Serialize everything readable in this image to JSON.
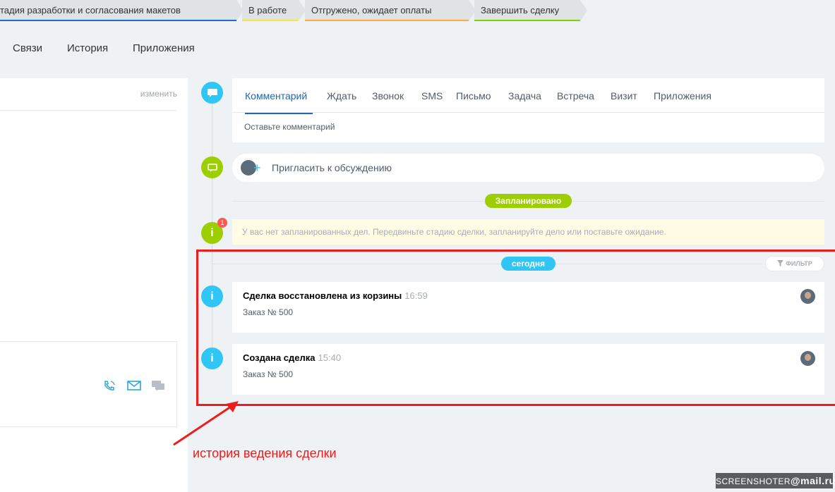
{
  "stages": [
    {
      "label": "тадия разработки и согласования макетов",
      "color": "#1e6ec8"
    },
    {
      "label": "В работе",
      "color": "#f7e43c"
    },
    {
      "label": "Отгружено, ожидает оплаты",
      "color": "#ffaa3c"
    },
    {
      "label": "Завершить сделку",
      "color": "#7bd500"
    }
  ],
  "top_tabs": [
    "Связи",
    "История",
    "Приложения"
  ],
  "left_panel": {
    "edit_label": "изменить"
  },
  "editor": {
    "tabs": [
      "Комментарий",
      "Ждать",
      "Звонок",
      "SMS",
      "Письмо",
      "Задача",
      "Встреча",
      "Визит",
      "Приложения"
    ],
    "placeholder": "Оставьте комментарий"
  },
  "invite": {
    "label": "Пригласить к обсуждению"
  },
  "planned_label": "Запланировано",
  "warning": {
    "text": "У вас нет запланированных дел. Передвиньте стадию сделки, запланируйте дело или поставьте ожидание.",
    "badge": "1"
  },
  "today_label": "сегодня",
  "filter_label": "ФИЛЬТР",
  "history": [
    {
      "title": "Сделка восстановлена из корзины",
      "time": "16:59",
      "subtitle": "Заказ № 500"
    },
    {
      "title": "Создана сделка",
      "time": "15:40",
      "subtitle": "Заказ № 500"
    }
  ],
  "annotation": "история ведения сделки",
  "watermark": {
    "prefix": "SCREENSHOTER",
    "suffix": "@mail.ru"
  },
  "icons": {
    "comment": "comment-icon",
    "chat": "chat-icon",
    "info": "info-icon",
    "phone": "phone-icon",
    "mail": "mail-icon",
    "message": "message-icon",
    "filter": "filter-icon"
  },
  "colors": {
    "accent_blue": "#2fc6f6",
    "accent_green": "#9dcf00",
    "active_tab": "#2067b0",
    "annotation_red": "#ee1c1c"
  }
}
